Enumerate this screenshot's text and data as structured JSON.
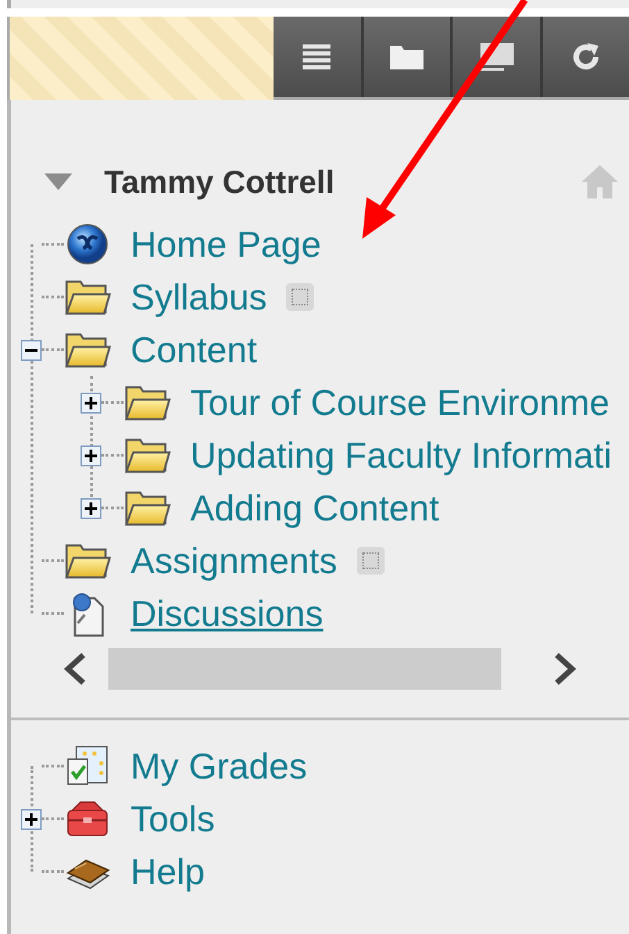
{
  "toolbar": [
    {
      "kind": "list"
    },
    {
      "kind": "folder"
    },
    {
      "kind": "screen"
    },
    {
      "kind": "refresh"
    }
  ],
  "course": {
    "title": "Tammy Cottrell",
    "expanded": true
  },
  "menu": [
    {
      "label": "Home Page",
      "kind": "globe",
      "marked": false,
      "hovered": false
    },
    {
      "label": "Syllabus",
      "kind": "folder",
      "marked": true,
      "hovered": false
    },
    {
      "label": "Content",
      "kind": "folder",
      "marked": false,
      "hovered": false,
      "expanded": true,
      "children": [
        {
          "label": "Tour of Course Environme",
          "kind": "folder",
          "marked": false,
          "hovered": false,
          "expanded": false
        },
        {
          "label": "Updating Faculty Informati",
          "kind": "folder",
          "marked": false,
          "hovered": false,
          "expanded": false
        },
        {
          "label": "Adding Content",
          "kind": "folder",
          "marked": false,
          "hovered": false,
          "expanded": false
        }
      ]
    },
    {
      "label": "Assignments",
      "kind": "folder",
      "marked": true,
      "hovered": false
    },
    {
      "label": "Discussions",
      "kind": "discussion",
      "marked": false,
      "hovered": true
    }
  ],
  "tools_menu": [
    {
      "label": "My Grades",
      "kind": "grades",
      "marked": false,
      "hovered": false
    },
    {
      "label": "Tools",
      "kind": "toolbox",
      "marked": false,
      "hovered": false,
      "expanded": false
    },
    {
      "label": "Help",
      "kind": "book",
      "marked": false,
      "hovered": false
    }
  ]
}
